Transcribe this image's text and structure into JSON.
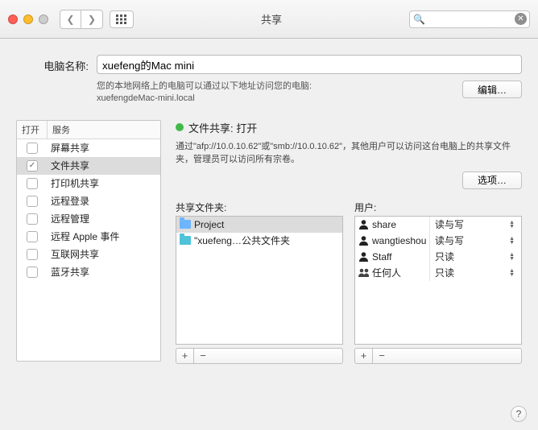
{
  "window": {
    "title": "共享",
    "search_placeholder": ""
  },
  "computer": {
    "label": "电脑名称:",
    "value": "xuefeng的Mac mini",
    "subtext1": "您的本地网络上的电脑可以通过以下地址访问您的电脑:",
    "subtext2": "xuefengdeMac-mini.local",
    "edit_label": "编辑…"
  },
  "svc_header": {
    "on": "打开",
    "svc": "服务"
  },
  "services": [
    {
      "on": false,
      "name": "屏幕共享",
      "sel": false
    },
    {
      "on": true,
      "name": "文件共享",
      "sel": true
    },
    {
      "on": false,
      "name": "打印机共享",
      "sel": false
    },
    {
      "on": false,
      "name": "远程登录",
      "sel": false
    },
    {
      "on": false,
      "name": "远程管理",
      "sel": false
    },
    {
      "on": false,
      "name": "远程 Apple 事件",
      "sel": false
    },
    {
      "on": false,
      "name": "互联网共享",
      "sel": false
    },
    {
      "on": false,
      "name": "蓝牙共享",
      "sel": false
    }
  ],
  "status": {
    "label": "文件共享: 打开",
    "desc": "通过\"afp://10.0.10.62\"或\"smb://10.0.10.62\"，其他用户可以访问这台电脑上的共享文件夹，管理员可以访问所有宗卷。",
    "options_label": "选项…"
  },
  "folders": {
    "header": "共享文件夹:",
    "items": [
      {
        "name": "Project",
        "sel": true,
        "alt": false
      },
      {
        "name": "\"xuefeng…公共文件夹",
        "sel": false,
        "alt": true
      }
    ]
  },
  "users": {
    "header": "用户:",
    "items": [
      {
        "icon": "single",
        "name": "share",
        "perm": "读与写"
      },
      {
        "icon": "single",
        "name": "wangtieshou",
        "perm": "读与写"
      },
      {
        "icon": "single",
        "name": "Staff",
        "perm": "只读"
      },
      {
        "icon": "group",
        "name": "任何人",
        "perm": "只读"
      }
    ]
  }
}
